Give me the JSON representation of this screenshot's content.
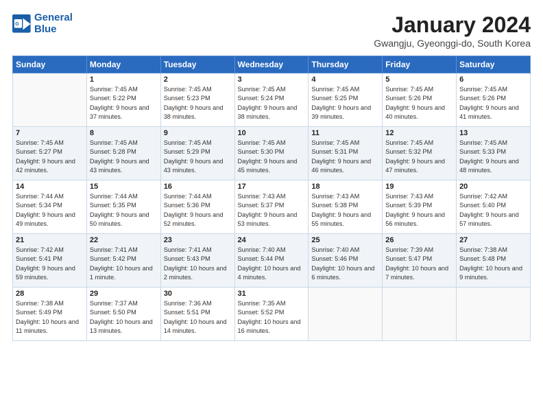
{
  "header": {
    "logo_line1": "General",
    "logo_line2": "Blue",
    "title": "January 2024",
    "subtitle": "Gwangju, Gyeonggi-do, South Korea"
  },
  "days_of_week": [
    "Sunday",
    "Monday",
    "Tuesday",
    "Wednesday",
    "Thursday",
    "Friday",
    "Saturday"
  ],
  "weeks": [
    [
      {
        "day": "",
        "sunrise": "",
        "sunset": "",
        "daylight": ""
      },
      {
        "day": "1",
        "sunrise": "Sunrise: 7:45 AM",
        "sunset": "Sunset: 5:22 PM",
        "daylight": "Daylight: 9 hours and 37 minutes."
      },
      {
        "day": "2",
        "sunrise": "Sunrise: 7:45 AM",
        "sunset": "Sunset: 5:23 PM",
        "daylight": "Daylight: 9 hours and 38 minutes."
      },
      {
        "day": "3",
        "sunrise": "Sunrise: 7:45 AM",
        "sunset": "Sunset: 5:24 PM",
        "daylight": "Daylight: 9 hours and 38 minutes."
      },
      {
        "day": "4",
        "sunrise": "Sunrise: 7:45 AM",
        "sunset": "Sunset: 5:25 PM",
        "daylight": "Daylight: 9 hours and 39 minutes."
      },
      {
        "day": "5",
        "sunrise": "Sunrise: 7:45 AM",
        "sunset": "Sunset: 5:26 PM",
        "daylight": "Daylight: 9 hours and 40 minutes."
      },
      {
        "day": "6",
        "sunrise": "Sunrise: 7:45 AM",
        "sunset": "Sunset: 5:26 PM",
        "daylight": "Daylight: 9 hours and 41 minutes."
      }
    ],
    [
      {
        "day": "7",
        "sunrise": "Sunrise: 7:45 AM",
        "sunset": "Sunset: 5:27 PM",
        "daylight": "Daylight: 9 hours and 42 minutes."
      },
      {
        "day": "8",
        "sunrise": "Sunrise: 7:45 AM",
        "sunset": "Sunset: 5:28 PM",
        "daylight": "Daylight: 9 hours and 43 minutes."
      },
      {
        "day": "9",
        "sunrise": "Sunrise: 7:45 AM",
        "sunset": "Sunset: 5:29 PM",
        "daylight": "Daylight: 9 hours and 43 minutes."
      },
      {
        "day": "10",
        "sunrise": "Sunrise: 7:45 AM",
        "sunset": "Sunset: 5:30 PM",
        "daylight": "Daylight: 9 hours and 45 minutes."
      },
      {
        "day": "11",
        "sunrise": "Sunrise: 7:45 AM",
        "sunset": "Sunset: 5:31 PM",
        "daylight": "Daylight: 9 hours and 46 minutes."
      },
      {
        "day": "12",
        "sunrise": "Sunrise: 7:45 AM",
        "sunset": "Sunset: 5:32 PM",
        "daylight": "Daylight: 9 hours and 47 minutes."
      },
      {
        "day": "13",
        "sunrise": "Sunrise: 7:45 AM",
        "sunset": "Sunset: 5:33 PM",
        "daylight": "Daylight: 9 hours and 48 minutes."
      }
    ],
    [
      {
        "day": "14",
        "sunrise": "Sunrise: 7:44 AM",
        "sunset": "Sunset: 5:34 PM",
        "daylight": "Daylight: 9 hours and 49 minutes."
      },
      {
        "day": "15",
        "sunrise": "Sunrise: 7:44 AM",
        "sunset": "Sunset: 5:35 PM",
        "daylight": "Daylight: 9 hours and 50 minutes."
      },
      {
        "day": "16",
        "sunrise": "Sunrise: 7:44 AM",
        "sunset": "Sunset: 5:36 PM",
        "daylight": "Daylight: 9 hours and 52 minutes."
      },
      {
        "day": "17",
        "sunrise": "Sunrise: 7:43 AM",
        "sunset": "Sunset: 5:37 PM",
        "daylight": "Daylight: 9 hours and 53 minutes."
      },
      {
        "day": "18",
        "sunrise": "Sunrise: 7:43 AM",
        "sunset": "Sunset: 5:38 PM",
        "daylight": "Daylight: 9 hours and 55 minutes."
      },
      {
        "day": "19",
        "sunrise": "Sunrise: 7:43 AM",
        "sunset": "Sunset: 5:39 PM",
        "daylight": "Daylight: 9 hours and 56 minutes."
      },
      {
        "day": "20",
        "sunrise": "Sunrise: 7:42 AM",
        "sunset": "Sunset: 5:40 PM",
        "daylight": "Daylight: 9 hours and 57 minutes."
      }
    ],
    [
      {
        "day": "21",
        "sunrise": "Sunrise: 7:42 AM",
        "sunset": "Sunset: 5:41 PM",
        "daylight": "Daylight: 9 hours and 59 minutes."
      },
      {
        "day": "22",
        "sunrise": "Sunrise: 7:41 AM",
        "sunset": "Sunset: 5:42 PM",
        "daylight": "Daylight: 10 hours and 1 minute."
      },
      {
        "day": "23",
        "sunrise": "Sunrise: 7:41 AM",
        "sunset": "Sunset: 5:43 PM",
        "daylight": "Daylight: 10 hours and 2 minutes."
      },
      {
        "day": "24",
        "sunrise": "Sunrise: 7:40 AM",
        "sunset": "Sunset: 5:44 PM",
        "daylight": "Daylight: 10 hours and 4 minutes."
      },
      {
        "day": "25",
        "sunrise": "Sunrise: 7:40 AM",
        "sunset": "Sunset: 5:46 PM",
        "daylight": "Daylight: 10 hours and 6 minutes."
      },
      {
        "day": "26",
        "sunrise": "Sunrise: 7:39 AM",
        "sunset": "Sunset: 5:47 PM",
        "daylight": "Daylight: 10 hours and 7 minutes."
      },
      {
        "day": "27",
        "sunrise": "Sunrise: 7:38 AM",
        "sunset": "Sunset: 5:48 PM",
        "daylight": "Daylight: 10 hours and 9 minutes."
      }
    ],
    [
      {
        "day": "28",
        "sunrise": "Sunrise: 7:38 AM",
        "sunset": "Sunset: 5:49 PM",
        "daylight": "Daylight: 10 hours and 11 minutes."
      },
      {
        "day": "29",
        "sunrise": "Sunrise: 7:37 AM",
        "sunset": "Sunset: 5:50 PM",
        "daylight": "Daylight: 10 hours and 13 minutes."
      },
      {
        "day": "30",
        "sunrise": "Sunrise: 7:36 AM",
        "sunset": "Sunset: 5:51 PM",
        "daylight": "Daylight: 10 hours and 14 minutes."
      },
      {
        "day": "31",
        "sunrise": "Sunrise: 7:35 AM",
        "sunset": "Sunset: 5:52 PM",
        "daylight": "Daylight: 10 hours and 16 minutes."
      },
      {
        "day": "",
        "sunrise": "",
        "sunset": "",
        "daylight": ""
      },
      {
        "day": "",
        "sunrise": "",
        "sunset": "",
        "daylight": ""
      },
      {
        "day": "",
        "sunrise": "",
        "sunset": "",
        "daylight": ""
      }
    ]
  ]
}
